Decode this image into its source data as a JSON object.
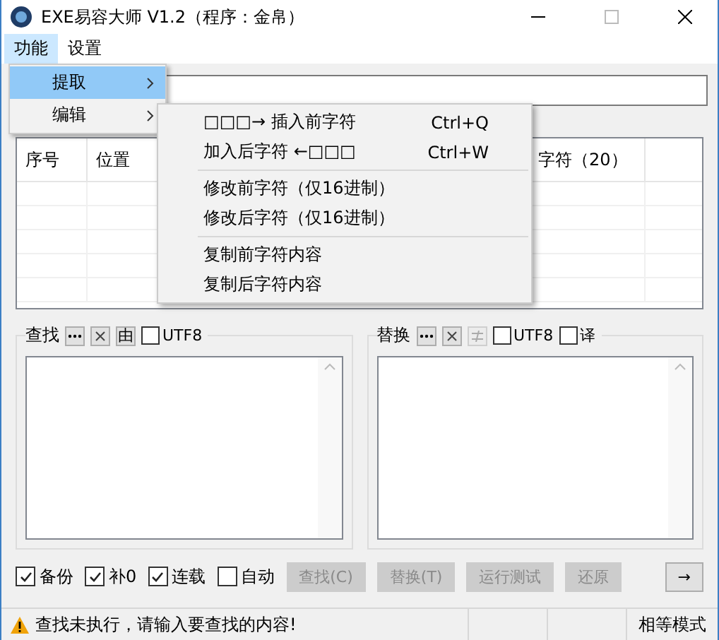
{
  "window": {
    "title": "EXE易容大师 V1.2（程序：金帛）"
  },
  "menubar": [
    {
      "label": "功能",
      "selected": true
    },
    {
      "label": "设置",
      "selected": false
    }
  ],
  "menu": [
    {
      "label": "提取",
      "selected": true,
      "has_submenu": true
    },
    {
      "label": "编辑",
      "selected": false,
      "has_submenu": true
    }
  ],
  "submenu": [
    [
      {
        "label": "□□□→ 插入前字符",
        "shortcut": "Ctrl+Q"
      },
      {
        "label": "加入后字符 ←□□□",
        "shortcut": "Ctrl+W"
      }
    ],
    [
      {
        "label": "修改前字符（仅16进制）"
      },
      {
        "label": "修改后字符（仅16进制）"
      }
    ],
    [
      {
        "label": "复制前字符内容"
      },
      {
        "label": "复制后字符内容"
      }
    ]
  ],
  "table": {
    "columns": [
      "序号",
      "位置",
      "字符（20）"
    ]
  },
  "panels": [
    {
      "title": "查找",
      "tools": [
        {
          "kind": "more",
          "disabled": false
        },
        {
          "kind": "clear",
          "disabled": false
        },
        {
          "kind": "text",
          "label": "由",
          "disabled": false
        }
      ],
      "options": [
        {
          "label": "UTF8",
          "checked": false
        }
      ]
    },
    {
      "title": "替换",
      "tools": [
        {
          "kind": "more",
          "disabled": false
        },
        {
          "kind": "clear",
          "disabled": false
        },
        {
          "kind": "swap",
          "disabled": true
        }
      ],
      "options": [
        {
          "label": "UTF8",
          "checked": false
        },
        {
          "label": "译",
          "checked": false
        }
      ]
    }
  ],
  "options": [
    {
      "label": "备份",
      "checked": true
    },
    {
      "label": "补0",
      "checked": true
    },
    {
      "label": "连载",
      "checked": true
    },
    {
      "label": "自动",
      "checked": false
    }
  ],
  "buttons": [
    {
      "label": "查找(C)",
      "disabled": true
    },
    {
      "label": "替换(T)",
      "disabled": true
    },
    {
      "label": "运行测试",
      "disabled": true
    },
    {
      "label": "还原",
      "disabled": true
    },
    {
      "label": "→",
      "disabled": false
    }
  ],
  "status_bar": {
    "message": "查找未执行，请输入要查找的内容!",
    "mode": "相等模式"
  }
}
